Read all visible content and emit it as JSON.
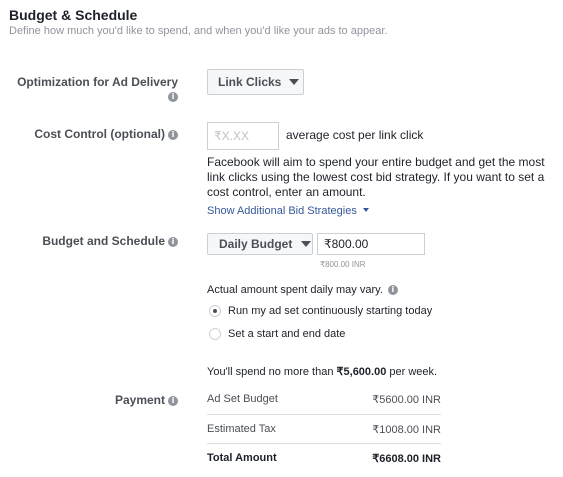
{
  "header": {
    "title": "Budget & Schedule",
    "subtitle": "Define how much you'd like to spend, and when you'd like your ads to appear."
  },
  "optimization": {
    "label": "Optimization for Ad Delivery",
    "value": "Link Clicks"
  },
  "cost_control": {
    "label": "Cost Control (optional)",
    "placeholder": "₹X.XX",
    "suffix": "average cost per link click",
    "help": "Facebook will aim to spend your entire budget and get the most link clicks using the lowest cost bid strategy. If you want to set a cost control, enter an amount.",
    "link": "Show Additional Bid Strategies"
  },
  "budget": {
    "label": "Budget and Schedule",
    "type": "Daily Budget",
    "amount": "₹800.00",
    "amount_note": "₹800.00 INR",
    "variance_note": "Actual amount spent daily may vary.",
    "options": [
      {
        "label": "Run my ad set continuously starting today",
        "selected": true
      },
      {
        "label": "Set a start and end date",
        "selected": false
      }
    ],
    "weekly_prefix": "You'll spend no more than ",
    "weekly_amount": "₹5,600.00",
    "weekly_suffix": " per week."
  },
  "payment": {
    "label": "Payment",
    "rows": [
      {
        "name": "Ad Set Budget",
        "value": "₹5600.00 INR"
      },
      {
        "name": "Estimated Tax",
        "value": "₹1008.00 INR"
      },
      {
        "name": "Total Amount",
        "value": "₹6608.00 INR"
      }
    ]
  },
  "colors": {
    "link": "#365899",
    "muted": "#90949c",
    "label": "#4b4f56"
  }
}
